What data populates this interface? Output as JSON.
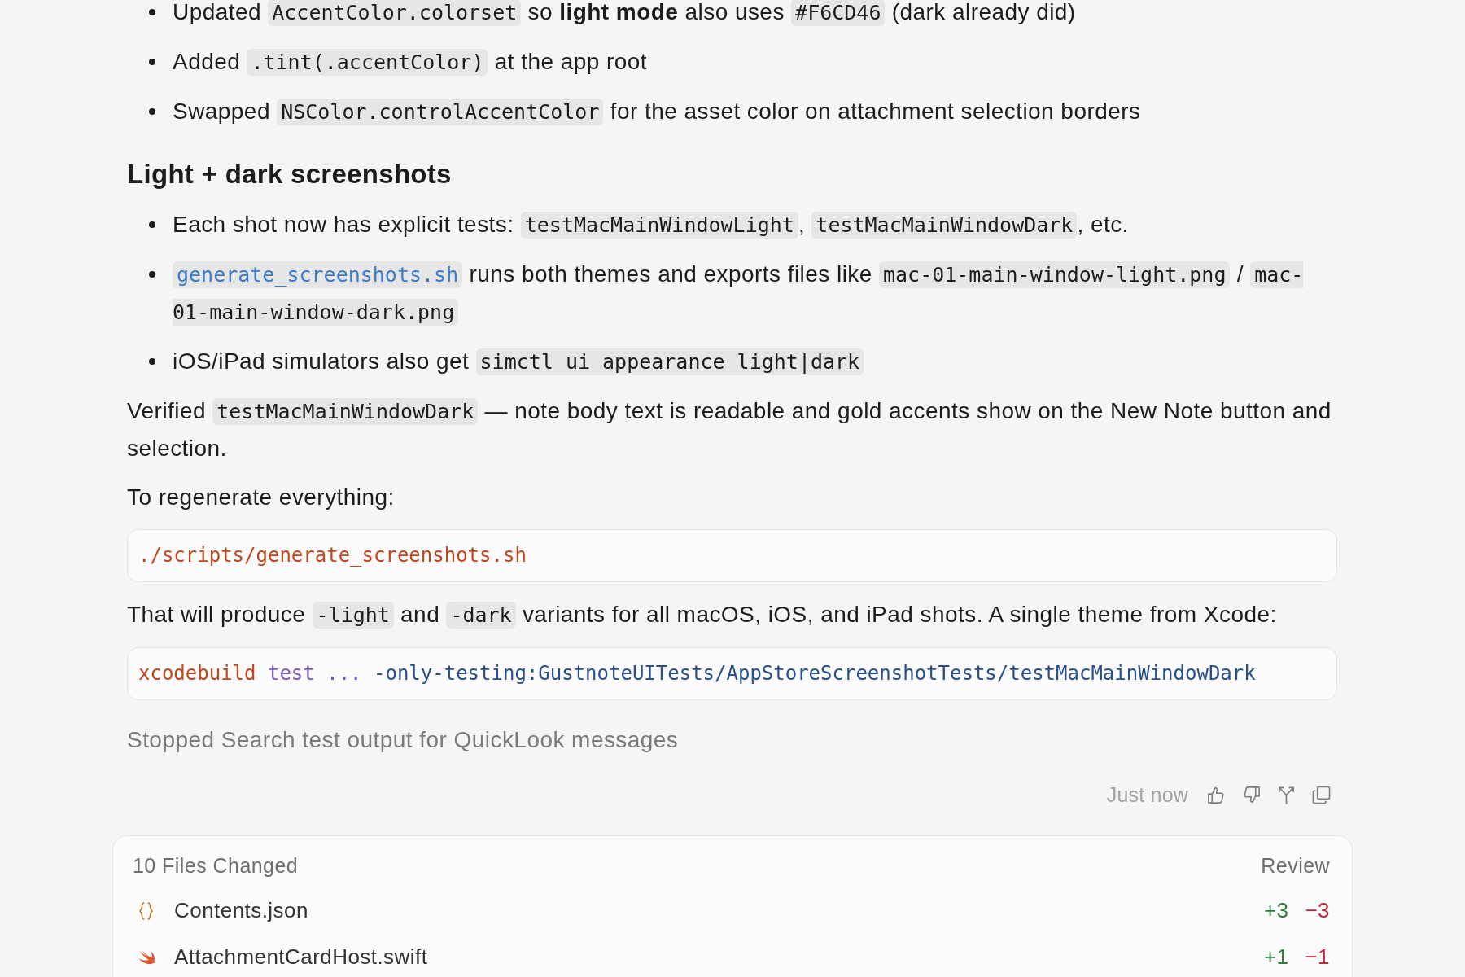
{
  "message": {
    "blocks": [
      {
        "kind": "list",
        "items": [
          {
            "segments": [
              {
                "kind": "text",
                "text": "Updated "
              },
              {
                "kind": "code",
                "text": "AccentColor.colorset"
              },
              {
                "kind": "text",
                "text": " so **light mode** also uses "
              },
              {
                "kind": "code",
                "text": "#F6CD46"
              },
              {
                "kind": "text",
                "text": " (dark already did)"
              }
            ]
          },
          {
            "segments": [
              {
                "kind": "text",
                "text": "Added "
              },
              {
                "kind": "code",
                "text": ".tint(.accentColor)"
              },
              {
                "kind": "text",
                "text": " at the app root"
              }
            ]
          },
          {
            "segments": [
              {
                "kind": "text",
                "text": "Swapped "
              },
              {
                "kind": "code",
                "text": "NSColor.controlAccentColor"
              },
              {
                "kind": "text",
                "text": " for the asset color on attachment selection borders"
              }
            ]
          }
        ]
      },
      {
        "kind": "heading",
        "text": "Light + dark screenshots"
      },
      {
        "kind": "list",
        "items": [
          {
            "segments": [
              {
                "kind": "text",
                "text": "Each shot now has explicit tests: "
              },
              {
                "kind": "code",
                "text": "testMacMainWindowLight"
              },
              {
                "kind": "text",
                "text": ", "
              },
              {
                "kind": "code",
                "text": "testMacMainWindowDark"
              },
              {
                "kind": "text",
                "text": ", etc."
              }
            ]
          },
          {
            "segments": [
              {
                "kind": "link",
                "text": "generate_screenshots.sh"
              },
              {
                "kind": "text",
                "text": " runs both themes and exports files like "
              },
              {
                "kind": "code",
                "text": "mac-01-main-window-light.png"
              },
              {
                "kind": "text",
                "text": " / "
              },
              {
                "kind": "code",
                "text": "mac-01-main-window-dark.png"
              }
            ]
          },
          {
            "segments": [
              {
                "kind": "text",
                "text": "iOS/iPad simulators also get "
              },
              {
                "kind": "code",
                "text": "simctl ui appearance light|dark"
              }
            ]
          }
        ]
      },
      {
        "kind": "paragraph",
        "segments": [
          {
            "kind": "text",
            "text": "Verified "
          },
          {
            "kind": "code",
            "text": "testMacMainWindowDark"
          },
          {
            "kind": "text",
            "text": " — note body text is readable and gold accents show on the New Note button and selection."
          }
        ]
      },
      {
        "kind": "paragraph",
        "segments": [
          {
            "kind": "text",
            "text": "To regenerate everything:"
          }
        ]
      },
      {
        "kind": "code",
        "tokens": [
          {
            "kind": "command",
            "text": "./scripts/generate_screenshots.sh"
          }
        ]
      },
      {
        "kind": "paragraph",
        "segments": [
          {
            "kind": "text",
            "text": "That will produce "
          },
          {
            "kind": "code",
            "text": "-light"
          },
          {
            "kind": "text",
            "text": " and "
          },
          {
            "kind": "code",
            "text": "-dark"
          },
          {
            "kind": "text",
            "text": " variants for all macOS, iOS, and iPad shots. A single theme from Xcode:"
          }
        ]
      },
      {
        "kind": "code",
        "tokens": [
          {
            "kind": "command",
            "text": "xcodebuild "
          },
          {
            "kind": "keyword",
            "text": "test "
          },
          {
            "kind": "operator",
            "text": "... "
          },
          {
            "kind": "option",
            "text": "-only-testing:GustnoteUITests/AppStoreScreenshotTests/testMacMainWindowDark"
          }
        ]
      }
    ],
    "activity": "Stopped Search test output for QuickLook messages",
    "timestamp": "Just now"
  },
  "changed_files": {
    "title": "10 Files Changed",
    "action": "Review",
    "files": [
      {
        "kind": "json",
        "name": "Contents.json",
        "added": "+3",
        "removed": "−3"
      },
      {
        "kind": "swift",
        "name": "AttachmentCardHost.swift",
        "added": "+1",
        "removed": "−1"
      }
    ]
  }
}
